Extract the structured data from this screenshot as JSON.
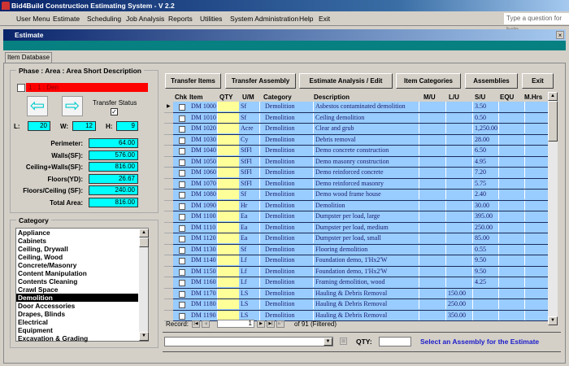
{
  "app": {
    "title": "Bid4Build Construction Estimating System - V 2.2",
    "ask_placeholder": "Type a question for help"
  },
  "menu": [
    "User Menu",
    "Estimate",
    "Scheduling",
    "Job Analysis",
    "Reports",
    "Utilities",
    "System Administration",
    "Help",
    "Exit"
  ],
  "window": {
    "title": "Estimate",
    "close": "×",
    "tab": "Item Database"
  },
  "phase": {
    "legend": "Phase : Area : Area Short Description",
    "selected": "1 : 1 : Den",
    "transfer_status_label": "Transfer Status",
    "transfer_status_checked": true,
    "L_label": "L:",
    "L": "20",
    "W_label": "W:",
    "W": "12",
    "H_label": "H:",
    "H": "9",
    "metrics": [
      {
        "label": "Perimeter:",
        "value": "64.00"
      },
      {
        "label": "Walls(SF):",
        "value": "576.00"
      },
      {
        "label": "Ceiling+Walls(SF):",
        "value": "816.00"
      },
      {
        "label": "Floors(YD):",
        "value": "26.67"
      },
      {
        "label": "Floors/Ceiling (SF):",
        "value": "240.00"
      },
      {
        "label": "Total Area:",
        "value": "816.00"
      }
    ]
  },
  "category": {
    "legend": "Category",
    "items": [
      "Appliance",
      "Cabinets",
      "Ceiling, Drywall",
      "Ceiling, Wood",
      "Concrete/Masonry",
      "Content Manipulation",
      "Contents Cleaning",
      "Crawl Space",
      "Demolition",
      "Door Accessories",
      "Drapes, Blinds",
      "Electrical",
      "Equipment",
      "Excavation & Grading"
    ],
    "selected": "Demolition"
  },
  "buttons": [
    "Transfer Items",
    "Transfer Assembly",
    "Estimate Analysis / Edit",
    "Item Categories",
    "Assemblies",
    "Exit"
  ],
  "grid": {
    "headers": [
      "Chk",
      "Item",
      "QTY",
      "U/M",
      "Category",
      "Description",
      "M/U",
      "L/U",
      "S/U",
      "EQU",
      "M.Hrs"
    ],
    "rows": [
      [
        "DM 1000",
        "Sf",
        "Demolition",
        "Asbestos contaminated demolition",
        "",
        "",
        "3.50"
      ],
      [
        "DM 1010",
        "Sf",
        "Demolition",
        "Ceiling demolition",
        "",
        "",
        "0.50"
      ],
      [
        "DM 1020",
        "Acre",
        "Demolition",
        "Clear and grub",
        "",
        "",
        "1,250.00"
      ],
      [
        "DM 1030",
        "Cy",
        "Demolition",
        "Debris removal",
        "",
        "",
        "28.00"
      ],
      [
        "DM 1040",
        "SfFl",
        "Demolition",
        "Demo concrete construction",
        "",
        "",
        "6.50"
      ],
      [
        "DM 1050",
        "SfFl",
        "Demolition",
        "Demo masonry construction",
        "",
        "",
        "4.95"
      ],
      [
        "DM 1060",
        "SfFl",
        "Demolition",
        "Demo reinforced concrete",
        "",
        "",
        "7.20"
      ],
      [
        "DM 1070",
        "SfFl",
        "Demolition",
        "Demo reinforced masonry",
        "",
        "",
        "5.75"
      ],
      [
        "DM 1080",
        "Sf",
        "Demolition",
        "Demo wood frame house",
        "",
        "",
        "2.40"
      ],
      [
        "DM 1090",
        "Hr",
        "Demolition",
        "Demolition",
        "",
        "",
        "30.00"
      ],
      [
        "DM 1100",
        "Ea",
        "Demolition",
        "Dumpster per load, large",
        "",
        "",
        "395.00"
      ],
      [
        "DM 1110",
        "Ea",
        "Demolition",
        "Dumpster per load, medium",
        "",
        "",
        "250.00"
      ],
      [
        "DM 1120",
        "Ea",
        "Demolition",
        "Dumpster per load, small",
        "",
        "",
        "85.00"
      ],
      [
        "DM 1130",
        "Sf",
        "Demolition",
        "Flooring demolition",
        "",
        "",
        "0.55"
      ],
      [
        "DM 1140",
        "Lf",
        "Demolition",
        "Foundation demo, 1'Hx2'W",
        "",
        "",
        "9.50"
      ],
      [
        "DM 1150",
        "Lf",
        "Demolition",
        "Foundation demo, 1'Hx2'W",
        "",
        "",
        "9.50"
      ],
      [
        "DM 1160",
        "Lf",
        "Demolition",
        "Framing demolition, wood",
        "",
        "",
        "4.25"
      ],
      [
        "DM 1170",
        "LS",
        "Demolition",
        "Hauling & Debris Removal",
        "",
        "150.00",
        ""
      ],
      [
        "DM 1180",
        "LS",
        "Demolition",
        "Hauling & Debris Removal",
        "",
        "250.00",
        ""
      ],
      [
        "DM 1190",
        "LS",
        "Demolition",
        "Hauling & Debris Removal",
        "",
        "350.00",
        ""
      ]
    ]
  },
  "record": {
    "label": "Record:",
    "current": "1",
    "of": "of  91 (Filtered)"
  },
  "bottom": {
    "qty_label": "QTY:",
    "message": "Select an Assembly for the Estimate"
  },
  "colors": {
    "row": "#99ccff",
    "qty": "#ffff99",
    "cyan": "#00ffff",
    "teal": "#068080",
    "message": "#1a1acc"
  }
}
